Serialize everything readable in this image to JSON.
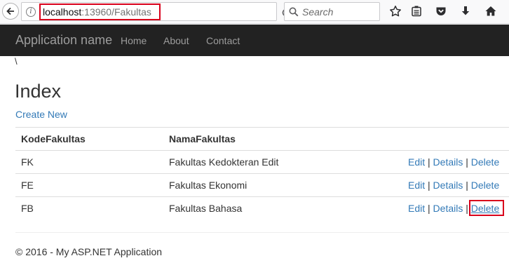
{
  "browser": {
    "url_host": "localhost",
    "url_rest": ":13960/Fakultas",
    "search_placeholder": "Search"
  },
  "navbar": {
    "brand": "Application name",
    "links": [
      "Home",
      "About",
      "Contact"
    ]
  },
  "page": {
    "backslash": "\\",
    "title": "Index",
    "create_new": "Create New"
  },
  "table": {
    "headers": [
      "KodeFakultas",
      "NamaFakultas"
    ],
    "rows": [
      {
        "kode": "FK",
        "nama": "Fakultas Kedokteran Edit"
      },
      {
        "kode": "FE",
        "nama": "Fakultas Ekonomi"
      },
      {
        "kode": "FB",
        "nama": "Fakultas Bahasa"
      }
    ],
    "actions": {
      "edit": "Edit",
      "details": "Details",
      "delete": "Delete",
      "separator": "|"
    }
  },
  "footer": "© 2016 - My ASP.NET Application",
  "colors": {
    "navbar": "#222222",
    "link": "#337ab7",
    "highlight": "#d9001b"
  },
  "icons": [
    "back-arrow-icon",
    "info-icon",
    "reload-icon",
    "search-icon",
    "star-icon",
    "reading-list-icon",
    "pocket-icon",
    "download-icon",
    "home-icon"
  ]
}
